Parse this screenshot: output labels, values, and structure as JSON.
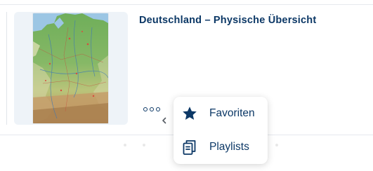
{
  "item": {
    "title": "Deutschland – Physische Übersicht",
    "thumbnail": "germany-physical-map"
  },
  "actions": {
    "more_icon": "ellipsis-icon",
    "collapse_icon": "chevron-left-icon"
  },
  "menu": {
    "items": [
      {
        "label": "Favoriten",
        "icon": "star-icon"
      },
      {
        "label": "Playlists",
        "icon": "playlist-icon"
      }
    ]
  },
  "colors": {
    "accent": "#0c3866",
    "card_bg": "#eef3f8",
    "divider": "#e6e9ee"
  }
}
